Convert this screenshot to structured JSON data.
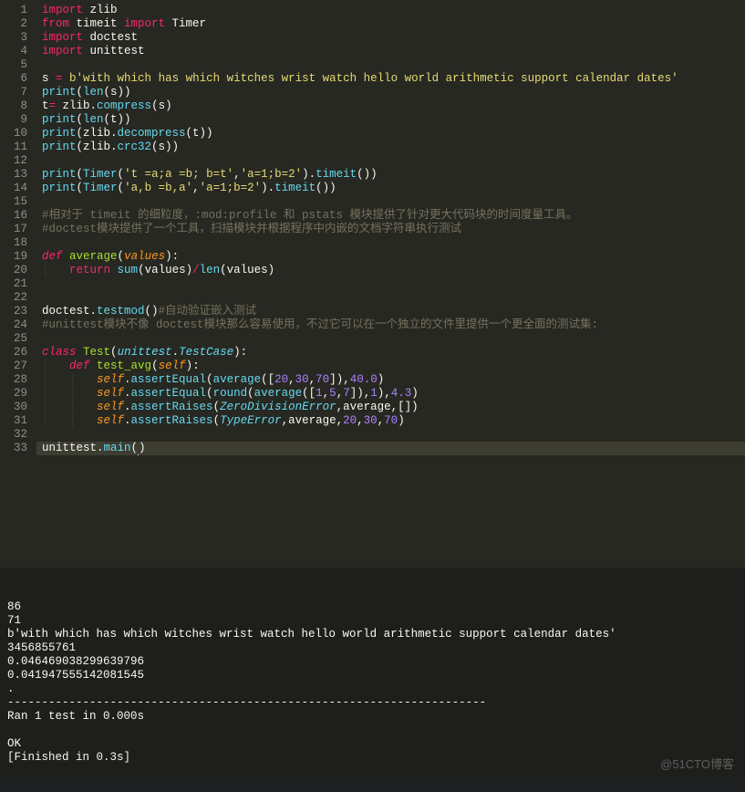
{
  "code": {
    "lines": [
      {
        "n": 1,
        "tokens": [
          [
            "kw",
            "import"
          ],
          [
            "plain",
            " zlib"
          ]
        ]
      },
      {
        "n": 2,
        "tokens": [
          [
            "kw",
            "from"
          ],
          [
            "plain",
            " timeit "
          ],
          [
            "kw",
            "import"
          ],
          [
            "plain",
            " Timer"
          ]
        ]
      },
      {
        "n": 3,
        "tokens": [
          [
            "kw",
            "import"
          ],
          [
            "plain",
            " doctest"
          ]
        ]
      },
      {
        "n": 4,
        "tokens": [
          [
            "kw",
            "import"
          ],
          [
            "plain",
            " unittest"
          ]
        ]
      },
      {
        "n": 5,
        "tokens": []
      },
      {
        "n": 6,
        "tokens": [
          [
            "plain",
            "s "
          ],
          [
            "op",
            "="
          ],
          [
            "plain",
            " "
          ],
          [
            "str",
            "b'with which has which witches wrist watch hello world arithmetic support calendar dates'"
          ]
        ]
      },
      {
        "n": 7,
        "tokens": [
          [
            "fn",
            "print"
          ],
          [
            "plain",
            "("
          ],
          [
            "fn",
            "len"
          ],
          [
            "plain",
            "(s))"
          ]
        ]
      },
      {
        "n": 8,
        "tokens": [
          [
            "plain",
            "t"
          ],
          [
            "op",
            "="
          ],
          [
            "plain",
            " zlib."
          ],
          [
            "fn",
            "compress"
          ],
          [
            "plain",
            "(s)"
          ]
        ]
      },
      {
        "n": 9,
        "tokens": [
          [
            "fn",
            "print"
          ],
          [
            "plain",
            "("
          ],
          [
            "fn",
            "len"
          ],
          [
            "plain",
            "(t))"
          ]
        ]
      },
      {
        "n": 10,
        "tokens": [
          [
            "fn",
            "print"
          ],
          [
            "plain",
            "(zlib."
          ],
          [
            "fn",
            "decompress"
          ],
          [
            "plain",
            "(t))"
          ]
        ]
      },
      {
        "n": 11,
        "tokens": [
          [
            "fn",
            "print"
          ],
          [
            "plain",
            "(zlib."
          ],
          [
            "fn",
            "crc32"
          ],
          [
            "plain",
            "(s))"
          ]
        ]
      },
      {
        "n": 12,
        "tokens": []
      },
      {
        "n": 13,
        "tokens": [
          [
            "fn",
            "print"
          ],
          [
            "plain",
            "("
          ],
          [
            "fn",
            "Timer"
          ],
          [
            "plain",
            "("
          ],
          [
            "str",
            "'t =a;a =b; b=t'"
          ],
          [
            "plain",
            ","
          ],
          [
            "str",
            "'a=1;b=2'"
          ],
          [
            "plain",
            ")."
          ],
          [
            "fn",
            "timeit"
          ],
          [
            "plain",
            "())"
          ]
        ]
      },
      {
        "n": 14,
        "tokens": [
          [
            "fn",
            "print"
          ],
          [
            "plain",
            "("
          ],
          [
            "fn",
            "Timer"
          ],
          [
            "plain",
            "("
          ],
          [
            "str",
            "'a,b =b,a'"
          ],
          [
            "plain",
            ","
          ],
          [
            "str",
            "'a=1;b=2'"
          ],
          [
            "plain",
            ")."
          ],
          [
            "fn",
            "timeit"
          ],
          [
            "plain",
            "())"
          ]
        ]
      },
      {
        "n": 15,
        "tokens": []
      },
      {
        "n": 16,
        "tokens": [
          [
            "cmt",
            "#相对于 timeit 的细粒度，:mod:profile 和 pstats 模块提供了针对更大代码块的时间度量工具。"
          ]
        ]
      },
      {
        "n": 17,
        "tokens": [
          [
            "cmt",
            "#doctest模块提供了一个工具，扫描模块并根据程序中内嵌的文档字符串执行测试"
          ]
        ]
      },
      {
        "n": 18,
        "tokens": []
      },
      {
        "n": 19,
        "tokens": [
          [
            "kw2",
            "def"
          ],
          [
            "plain",
            " "
          ],
          [
            "name",
            "average"
          ],
          [
            "plain",
            "("
          ],
          [
            "arg",
            "values"
          ],
          [
            "plain",
            "):"
          ]
        ]
      },
      {
        "n": 20,
        "tokens": [
          [
            "indent-guide",
            "│   "
          ],
          [
            "kw",
            "return"
          ],
          [
            "plain",
            " "
          ],
          [
            "fn",
            "sum"
          ],
          [
            "plain",
            "(values)"
          ],
          [
            "op",
            "/"
          ],
          [
            "fn",
            "len"
          ],
          [
            "plain",
            "(values)"
          ]
        ]
      },
      {
        "n": 21,
        "tokens": []
      },
      {
        "n": 22,
        "tokens": []
      },
      {
        "n": 23,
        "tokens": [
          [
            "plain",
            "doctest."
          ],
          [
            "fn",
            "testmod"
          ],
          [
            "plain",
            "()"
          ],
          [
            "cmt",
            "#自动验证嵌入测试"
          ]
        ]
      },
      {
        "n": 24,
        "tokens": [
          [
            "cmt",
            "#unittest模块不像 doctest模块那么容易使用，不过它可以在一个独立的文件里提供一个更全面的测试集:"
          ]
        ]
      },
      {
        "n": 25,
        "tokens": []
      },
      {
        "n": 26,
        "tokens": [
          [
            "kw2",
            "class"
          ],
          [
            "plain",
            " "
          ],
          [
            "name",
            "Test"
          ],
          [
            "plain",
            "("
          ],
          [
            "fnlt",
            "unittest"
          ],
          [
            "plain",
            "."
          ],
          [
            "fnlt",
            "TestCase"
          ],
          [
            "plain",
            "):"
          ]
        ]
      },
      {
        "n": 27,
        "tokens": [
          [
            "indent-guide",
            "│   "
          ],
          [
            "kw2",
            "def"
          ],
          [
            "plain",
            " "
          ],
          [
            "name",
            "test_avg"
          ],
          [
            "plain",
            "("
          ],
          [
            "arg",
            "self"
          ],
          [
            "plain",
            "):"
          ]
        ]
      },
      {
        "n": 28,
        "tokens": [
          [
            "indent-guide",
            "│   │   "
          ],
          [
            "arg",
            "self"
          ],
          [
            "plain",
            "."
          ],
          [
            "fn",
            "assertEqual"
          ],
          [
            "plain",
            "("
          ],
          [
            "fn",
            "average"
          ],
          [
            "plain",
            "(["
          ],
          [
            "num",
            "20"
          ],
          [
            "plain",
            ","
          ],
          [
            "num",
            "30"
          ],
          [
            "plain",
            ","
          ],
          [
            "num",
            "70"
          ],
          [
            "plain",
            "]),"
          ],
          [
            "num",
            "40.0"
          ],
          [
            "plain",
            ")"
          ]
        ]
      },
      {
        "n": 29,
        "tokens": [
          [
            "indent-guide",
            "│   │   "
          ],
          [
            "arg",
            "self"
          ],
          [
            "plain",
            "."
          ],
          [
            "fn",
            "assertEqual"
          ],
          [
            "plain",
            "("
          ],
          [
            "fn",
            "round"
          ],
          [
            "plain",
            "("
          ],
          [
            "fn",
            "average"
          ],
          [
            "plain",
            "(["
          ],
          [
            "num",
            "1"
          ],
          [
            "plain",
            ","
          ],
          [
            "num",
            "5"
          ],
          [
            "plain",
            ","
          ],
          [
            "num",
            "7"
          ],
          [
            "plain",
            "]),"
          ],
          [
            "num",
            "1"
          ],
          [
            "plain",
            ")"
          ],
          [
            "plain",
            ","
          ],
          [
            "num",
            "4.3"
          ],
          [
            "plain",
            ")"
          ]
        ]
      },
      {
        "n": 30,
        "tokens": [
          [
            "indent-guide",
            "│   │   "
          ],
          [
            "arg",
            "self"
          ],
          [
            "plain",
            "."
          ],
          [
            "fn",
            "assertRaises"
          ],
          [
            "plain",
            "("
          ],
          [
            "fnlt",
            "ZeroDivisionError"
          ],
          [
            "plain",
            ",average,[])"
          ]
        ]
      },
      {
        "n": 31,
        "tokens": [
          [
            "indent-guide",
            "│   │   "
          ],
          [
            "arg",
            "self"
          ],
          [
            "plain",
            "."
          ],
          [
            "fn",
            "assertRaises"
          ],
          [
            "plain",
            "("
          ],
          [
            "fnlt",
            "TypeError"
          ],
          [
            "plain",
            ",average,"
          ],
          [
            "num",
            "20"
          ],
          [
            "plain",
            ","
          ],
          [
            "num",
            "30"
          ],
          [
            "plain",
            ","
          ],
          [
            "num",
            "70"
          ],
          [
            "plain",
            ")"
          ]
        ]
      },
      {
        "n": 32,
        "tokens": []
      },
      {
        "n": 33,
        "hl": true,
        "tokens": [
          [
            "plain",
            "unittest."
          ],
          [
            "fn",
            "main"
          ],
          [
            "plain",
            "("
          ],
          [
            "cursor",
            ""
          ],
          [
            "plain",
            ")"
          ]
        ]
      }
    ]
  },
  "output": {
    "lines": [
      "86",
      "71",
      "b'with which has which witches wrist watch hello world arithmetic support calendar dates'",
      "3456855761",
      "0.046469038299639796",
      "0.041947555142081545",
      ".",
      "----------------------------------------------------------------------",
      "Ran 1 test in 0.000s",
      "",
      "OK",
      "[Finished in 0.3s]"
    ]
  },
  "watermark": "@51CTO博客"
}
